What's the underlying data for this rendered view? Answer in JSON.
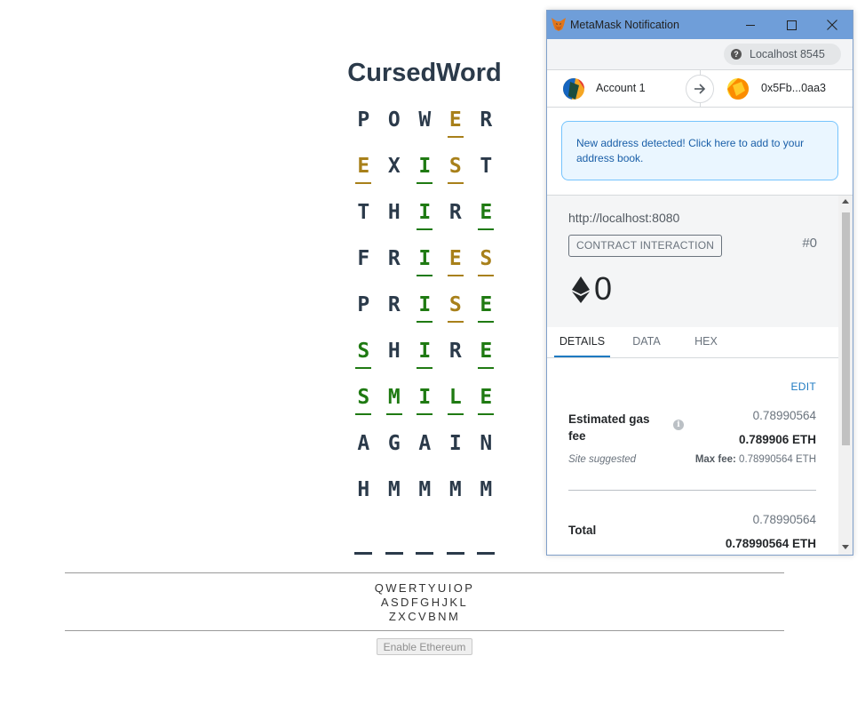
{
  "game": {
    "title": "CursedWord",
    "rows": [
      [
        {
          "l": "P",
          "s": "n"
        },
        {
          "l": "O",
          "s": "n"
        },
        {
          "l": "W",
          "s": "n"
        },
        {
          "l": "E",
          "s": "p"
        },
        {
          "l": "R",
          "s": "n"
        }
      ],
      [
        {
          "l": "E",
          "s": "p"
        },
        {
          "l": "X",
          "s": "n"
        },
        {
          "l": "I",
          "s": "m"
        },
        {
          "l": "S",
          "s": "p"
        },
        {
          "l": "T",
          "s": "n"
        }
      ],
      [
        {
          "l": "T",
          "s": "n"
        },
        {
          "l": "H",
          "s": "n"
        },
        {
          "l": "I",
          "s": "m"
        },
        {
          "l": "R",
          "s": "n"
        },
        {
          "l": "E",
          "s": "m"
        }
      ],
      [
        {
          "l": "F",
          "s": "n"
        },
        {
          "l": "R",
          "s": "n"
        },
        {
          "l": "I",
          "s": "m"
        },
        {
          "l": "E",
          "s": "p"
        },
        {
          "l": "S",
          "s": "p"
        }
      ],
      [
        {
          "l": "P",
          "s": "n"
        },
        {
          "l": "R",
          "s": "n"
        },
        {
          "l": "I",
          "s": "m"
        },
        {
          "l": "S",
          "s": "p"
        },
        {
          "l": "E",
          "s": "m"
        }
      ],
      [
        {
          "l": "S",
          "s": "m"
        },
        {
          "l": "H",
          "s": "n"
        },
        {
          "l": "I",
          "s": "m"
        },
        {
          "l": "R",
          "s": "n"
        },
        {
          "l": "E",
          "s": "m"
        }
      ],
      [
        {
          "l": "S",
          "s": "m"
        },
        {
          "l": "M",
          "s": "m"
        },
        {
          "l": "I",
          "s": "m"
        },
        {
          "l": "L",
          "s": "m"
        },
        {
          "l": "E",
          "s": "m"
        }
      ],
      [
        {
          "l": "A",
          "s": "n"
        },
        {
          "l": "G",
          "s": "n"
        },
        {
          "l": "A",
          "s": "n"
        },
        {
          "l": "I",
          "s": "n"
        },
        {
          "l": "N",
          "s": "n"
        }
      ],
      [
        {
          "l": "H",
          "s": "n"
        },
        {
          "l": "M",
          "s": "n"
        },
        {
          "l": "M",
          "s": "n"
        },
        {
          "l": "M",
          "s": "n"
        },
        {
          "l": "M",
          "s": "n"
        }
      ]
    ],
    "blank_count": 5,
    "keyboard": [
      "QWERTYUIOP",
      "ASDFGHJKL",
      "ZXCVBNM"
    ],
    "enable_button": "Enable Ethereum",
    "colors": {
      "match": "#1f7a12",
      "present": "#a8801a",
      "text": "#2b3a4a"
    }
  },
  "metamask": {
    "window_title": "MetaMask Notification",
    "network": "Localhost 8545",
    "from_account": "Account 1",
    "to_address": "0x5Fb...0aa3",
    "notice": "New address detected! Click here to add to your address book.",
    "site": "http://localhost:8080",
    "badge": "CONTRACT INTERACTION",
    "nonce": "#0",
    "amount": "0",
    "tabs": [
      "DETAILS",
      "DATA",
      "HEX"
    ],
    "edit": "EDIT",
    "gas": {
      "label": "Estimated gas fee",
      "secondary": "0.78990564",
      "primary": "0.789906 ETH",
      "site_suggested": "Site suggested",
      "max_fee_label": "Max fee:",
      "max_fee_value": "0.78990564 ETH"
    },
    "total": {
      "label": "Total",
      "secondary": "0.78990564",
      "primary": "0.78990564 ETH"
    },
    "accent": "#1e7ac1"
  }
}
